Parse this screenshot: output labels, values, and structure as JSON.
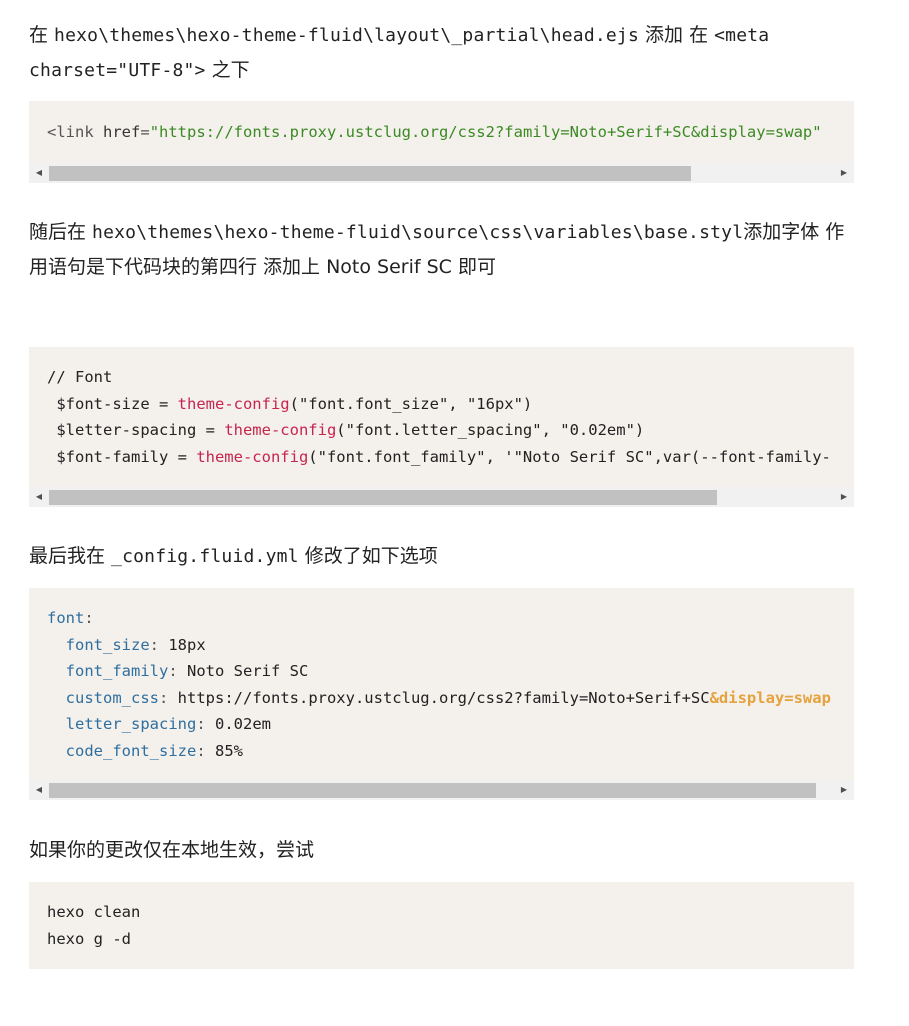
{
  "p1": {
    "prefix": "在 ",
    "path": "hexo\\themes\\hexo-theme-fluid\\layout\\_partial\\head.ejs",
    "middle": " 添加 在 ",
    "code": "<meta charset=\"UTF-8\">",
    "suffix": " 之下"
  },
  "block1": {
    "tag_open": "<link",
    "attr": " href",
    "eq": "=",
    "value": "\"https://fonts.proxy.ustclug.org/css2?family=Noto+Serif+SC&display=swap\""
  },
  "p2": {
    "prefix": "随后在 ",
    "path": "hexo\\themes\\hexo-theme-fluid\\source\\css\\variables\\base.styl",
    "suffix": "添加字体 作用语句是下代码块的第四行 添加上 Noto Serif SC 即可"
  },
  "block2": {
    "comment": "// Font",
    "lines": [
      {
        "var": " $font-size = ",
        "fn": "theme-config",
        "args": "(\"font.font_size\", \"16px\")"
      },
      {
        "var": " $letter-spacing = ",
        "fn": "theme-config",
        "args": "(\"font.letter_spacing\", \"0.02em\")"
      },
      {
        "var": " $font-family = ",
        "fn": "theme-config",
        "args": "(\"font.font_family\", '\"Noto Serif SC\",var(--font-family-"
      }
    ]
  },
  "p3": {
    "prefix": "最后我在 ",
    "file": "_config.fluid.yml",
    "suffix": " 修改了如下选项"
  },
  "block3": {
    "root_key": "font",
    "items": [
      {
        "key": "font_size",
        "value": "18px"
      },
      {
        "key": "font_family",
        "value": "Noto Serif SC"
      },
      {
        "key": "custom_css",
        "value": "https://fonts.proxy.ustclug.org/css2?family=Noto+Serif+SC",
        "entity": "&display=swap"
      },
      {
        "key": "letter_spacing",
        "value": "0.02em"
      },
      {
        "key": "code_font_size",
        "value": "85%"
      }
    ]
  },
  "p4": {
    "text": "如果你的更改仅在本地生效，尝试"
  },
  "block4": {
    "lines": [
      "hexo clean",
      "hexo g -d"
    ]
  },
  "icons": {
    "scroll_left": "◀",
    "scroll_right": "▶"
  }
}
